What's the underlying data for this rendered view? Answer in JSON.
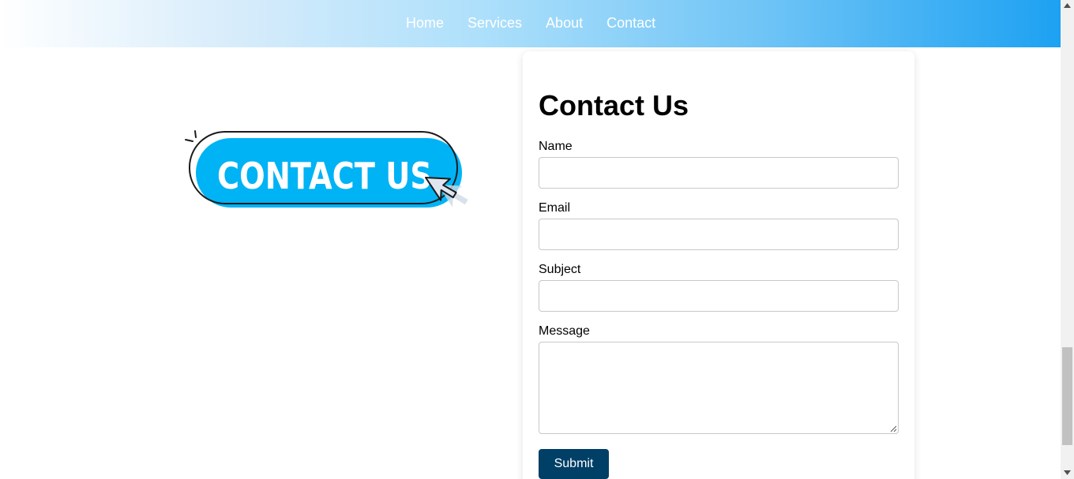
{
  "nav": {
    "items": [
      {
        "label": "Home"
      },
      {
        "label": "Services"
      },
      {
        "label": "About"
      },
      {
        "label": "Contact"
      }
    ]
  },
  "hero": {
    "image_text": "CONTACT US",
    "accent_color": "#00b3f5",
    "icon": "cursor-arrow-icon"
  },
  "form": {
    "title": "Contact Us",
    "fields": [
      {
        "label": "Name",
        "value": "",
        "placeholder": ""
      },
      {
        "label": "Email",
        "value": "",
        "placeholder": ""
      },
      {
        "label": "Subject",
        "value": "",
        "placeholder": ""
      },
      {
        "label": "Message",
        "value": "",
        "placeholder": ""
      }
    ],
    "submit_label": "Submit",
    "submit_color": "#003f66"
  },
  "theme": {
    "nav_gradient_end": "#1da1f2"
  }
}
